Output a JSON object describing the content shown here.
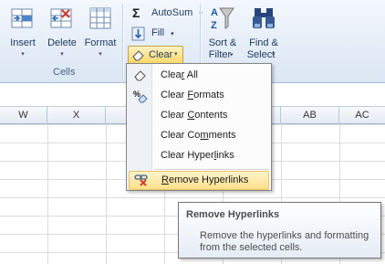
{
  "ribbon": {
    "insert_label": "Insert",
    "delete_label": "Delete",
    "format_label": "Format",
    "cells_group_label": "Cells",
    "autosum_label": "AutoSum",
    "fill_label": "Fill",
    "clear_label": "Clear",
    "sort_filter_label_1": "Sort &",
    "sort_filter_label_2": "Filter",
    "find_select_label_1": "Find &",
    "find_select_label_2": "Select",
    "dropdown_glyph": "▾",
    "sigma_glyph": "Σ"
  },
  "columns": [
    "W",
    "X",
    "",
    "",
    "",
    "AB",
    "AC"
  ],
  "clear_menu": {
    "items": [
      {
        "pre": "Clea",
        "u": "r",
        "post": " All",
        "icon": "eraser-icon"
      },
      {
        "pre": "Clear ",
        "u": "F",
        "post": "ormats",
        "icon": "clear-formats-icon"
      },
      {
        "pre": "Clear ",
        "u": "C",
        "post": "ontents",
        "icon": ""
      },
      {
        "pre": "Clear Co",
        "u": "m",
        "post": "ments",
        "icon": ""
      },
      {
        "pre": "Clear Hyper",
        "u": "l",
        "post": "inks",
        "icon": ""
      },
      {
        "pre": "",
        "u": "R",
        "post": "emove Hyperlinks",
        "icon": "remove-hyperlink-icon"
      }
    ]
  },
  "tooltip": {
    "title": "Remove Hyperlinks",
    "body": "Remove the hyperlinks and formatting from the selected cells."
  },
  "colors": {
    "highlight": "#ffe08a",
    "ribbon_bg": "#dbe6f4",
    "text": "#1e395b"
  }
}
